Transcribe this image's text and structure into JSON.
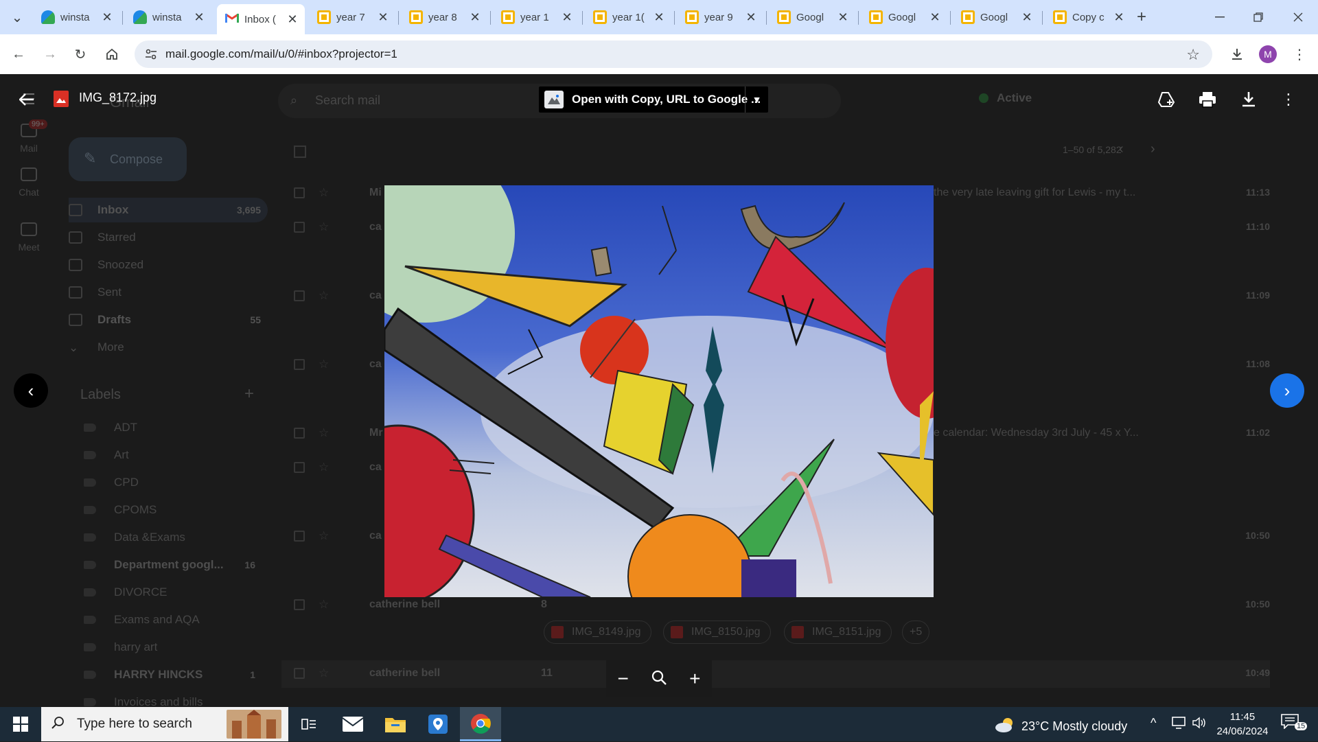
{
  "browser": {
    "tabs": [
      {
        "title": "winsta",
        "favicon": "sites-icon"
      },
      {
        "title": "winsta",
        "favicon": "sites-icon"
      },
      {
        "title": "Inbox (",
        "favicon": "gmail-icon",
        "active": true
      },
      {
        "title": "year 7",
        "favicon": "slides-icon"
      },
      {
        "title": "year 8",
        "favicon": "slides-icon"
      },
      {
        "title": "year 1",
        "favicon": "slides-icon"
      },
      {
        "title": "year 1(",
        "favicon": "slides-icon"
      },
      {
        "title": "year 9",
        "favicon": "slides-icon"
      },
      {
        "title": "Googl",
        "favicon": "slides-icon"
      },
      {
        "title": "Googl",
        "favicon": "slides-icon"
      },
      {
        "title": "Googl",
        "favicon": "slides-icon"
      },
      {
        "title": "Copy c",
        "favicon": "slides-icon"
      }
    ],
    "close_glyph": "✕",
    "new_tab_glyph": "+",
    "url": "mail.google.com/mail/u/0/#inbox?projector=1",
    "profile_initial": "M"
  },
  "gmail": {
    "logo_text": "Gmail",
    "search_placeholder": "Search mail",
    "status": "Active",
    "rail": [
      {
        "label": "Mail",
        "badge": "99+"
      },
      {
        "label": "Chat"
      },
      {
        "label": "Meet"
      }
    ],
    "compose_label": "Compose",
    "nav": [
      {
        "label": "Inbox",
        "count": "3,695",
        "bold": true
      },
      {
        "label": "Starred",
        "count": ""
      },
      {
        "label": "Snoozed",
        "count": ""
      },
      {
        "label": "Sent",
        "count": ""
      },
      {
        "label": "Drafts",
        "count": "55",
        "bold": true
      },
      {
        "label": "More",
        "count": ""
      }
    ],
    "labels_heading": "Labels",
    "labels": [
      {
        "name": "ADT",
        "count": ""
      },
      {
        "name": "Art",
        "count": ""
      },
      {
        "name": "CPD",
        "count": ""
      },
      {
        "name": "CPOMS",
        "count": ""
      },
      {
        "name": "Data &Exams",
        "count": ""
      },
      {
        "name": "Department googl...",
        "count": "16",
        "bold": true
      },
      {
        "name": "DIVORCE",
        "count": ""
      },
      {
        "name": "Exams and AQA",
        "count": ""
      },
      {
        "name": "harry art",
        "count": ""
      },
      {
        "name": "HARRY HINCKS",
        "count": "1",
        "bold": true
      },
      {
        "name": "Invoices and bills",
        "count": ""
      }
    ],
    "pagination": "1–50 of 5,282",
    "rows": [
      {
        "sender": "Mi",
        "preview": "the very late leaving gift for Lewis - my t...",
        "time": "11:13"
      },
      {
        "sender": "ca",
        "preview": "",
        "time": "11:10"
      },
      {
        "sender": "ca",
        "preview": "",
        "time": "11:09"
      },
      {
        "sender": "ca",
        "preview": "",
        "time": "11:08"
      },
      {
        "sender": "Mr",
        "preview": "e calendar: Wednesday 3rd July - 45 x Y...",
        "time": "11:02"
      },
      {
        "sender": "ca",
        "preview": "",
        "time": ""
      },
      {
        "sender": "ca",
        "preview": "",
        "time": "10:50"
      },
      {
        "sender": "catherine bell",
        "count": "8",
        "preview": "",
        "time": "10:50"
      },
      {
        "sender": "catherine bell",
        "count": "11",
        "preview": "",
        "time": "10:49"
      }
    ],
    "attachments": [
      "IMG_8149.jpg",
      "IMG_8150.jpg",
      "IMG_8151.jpg",
      "+5"
    ]
  },
  "viewer": {
    "filename": "IMG_8172.jpg",
    "open_with": "Open with Copy, URL to Google ...",
    "zoom_out": "−",
    "zoom_in": "+"
  },
  "taskbar": {
    "search_placeholder": "Type here to search",
    "weather": "23°C  Mostly cloudy",
    "time": "11:45",
    "date": "24/06/2024",
    "notifications": "15"
  },
  "colors": {
    "tabstrip": "#d3e3fd",
    "accent_blue": "#1a73e8",
    "taskbar": "#1c2b38"
  }
}
